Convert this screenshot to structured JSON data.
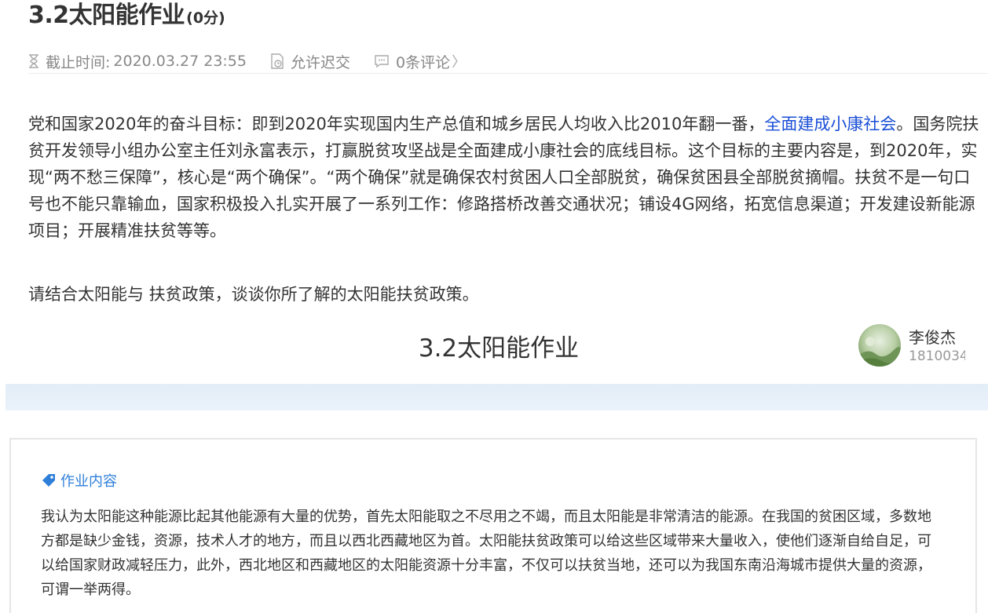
{
  "assignment": {
    "title": "3.2太阳能作业",
    "score": "(0分)",
    "deadline_label": "截止时间:",
    "deadline_value": "2020.03.27 23:55",
    "late_label": "允许迟交",
    "comments_label": "0条评论",
    "comments_arrow": "〉",
    "description_before_link": "党和国家2020年的奋斗目标：即到2020年实现国内生产总值和城乡居民人均收入比2010年翻一番，",
    "description_link": "全面建成小康社会",
    "description_after_link": "。国务院扶贫开发领导小组办公室主任刘永富表示，打赢脱贫攻坚战是全面建成小康社会的底线目标。这个目标的主要内容是，到2020年，实现“两不愁三保障”，核心是“两个确保”。“两个确保”就是确保农村贫困人口全部脱贫，确保贫困县全部脱贫摘帽。扶贫不是一句口号也不能只靠输血，国家积极投入扎实开展了一系列工作：修路搭桥改善交通状况；铺设4G网络，拓宽信息渠道；开发建设新能源项目；开展精准扶贫等等。",
    "question": "请结合太阳能与 扶贫政策，谈谈你所了解的太阳能扶贫政策。"
  },
  "submission": {
    "title": "3.2太阳能作业",
    "author_name": "李俊杰",
    "author_id": "1810034",
    "content_label": "作业内容",
    "content_text": "我认为太阳能这种能源比起其他能源有大量的优势，首先太阳能取之不尽用之不竭，而且太阳能是非常清洁的能源。在我国的贫困区域，多数地方都是缺少金钱，资源，技术人才的地方，而且以西北西藏地区为首。太阳能扶贫政策可以给这些区域带来大量收入，使他们逐渐自给自足，可以给国家财政减轻压力，此外，西北地区和西藏地区的太阳能资源十分丰富，不仅可以扶贫当地，还可以为我国东南沿海城市提供大量的资源，可谓一举两得。"
  },
  "colors": {
    "link": "#1a4fd6",
    "label_accent": "#2f7fd9",
    "strip": "#e6eff8"
  }
}
